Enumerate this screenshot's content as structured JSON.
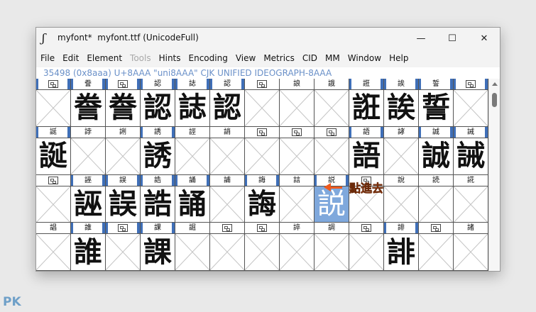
{
  "window": {
    "title": "myfont*  myfont.ttf (UnicodeFull)",
    "app_icon": "ʃ",
    "controls": {
      "minimize": "—",
      "maximize": "☐",
      "close": "✕"
    }
  },
  "menu": [
    {
      "label": "File",
      "disabled": false
    },
    {
      "label": "Edit",
      "disabled": false
    },
    {
      "label": "Element",
      "disabled": false
    },
    {
      "label": "Tools",
      "disabled": true
    },
    {
      "label": "Hints",
      "disabled": false
    },
    {
      "label": "Encoding",
      "disabled": false
    },
    {
      "label": "View",
      "disabled": false
    },
    {
      "label": "Metrics",
      "disabled": false
    },
    {
      "label": "CID",
      "disabled": false
    },
    {
      "label": "MM",
      "disabled": false
    },
    {
      "label": "Window",
      "disabled": false
    },
    {
      "label": "Help",
      "disabled": false
    }
  ],
  "info_line": "35498 (0x8aaa) U+8AAA \"uni8AAA\" CJK UNIFIED IDEOGRAPH-8AAA",
  "grid": {
    "rows": [
      [
        {
          "label": "",
          "glyph": "",
          "marked": true
        },
        {
          "label": "誊",
          "glyph": "誊",
          "marked": true
        },
        {
          "label": "",
          "glyph": "誊",
          "marked": true
        },
        {
          "label": "認",
          "glyph": "認",
          "marked": true
        },
        {
          "label": "誌",
          "glyph": "誌",
          "marked": true
        },
        {
          "label": "認",
          "glyph": "認",
          "marked": true
        },
        {
          "label": "",
          "glyph": "",
          "marked": false
        },
        {
          "label": "誏",
          "glyph": "",
          "marked": false
        },
        {
          "label": "誐",
          "glyph": "",
          "marked": false
        },
        {
          "label": "誑",
          "glyph": "誑",
          "marked": true
        },
        {
          "label": "誒",
          "glyph": "誒",
          "marked": true
        },
        {
          "label": "誓",
          "glyph": "誓",
          "marked": true
        },
        {
          "label": "",
          "glyph": "",
          "marked": true
        }
      ],
      [
        {
          "label": "誕",
          "glyph": "誕",
          "marked": true
        },
        {
          "label": "誖",
          "glyph": "",
          "marked": false
        },
        {
          "label": "誗",
          "glyph": "",
          "marked": false
        },
        {
          "label": "誘",
          "glyph": "誘",
          "marked": true
        },
        {
          "label": "誙",
          "glyph": "",
          "marked": false
        },
        {
          "label": "誚",
          "glyph": "",
          "marked": false
        },
        {
          "label": "",
          "glyph": "",
          "marked": false
        },
        {
          "label": "",
          "glyph": "",
          "marked": false
        },
        {
          "label": "",
          "glyph": "",
          "marked": false
        },
        {
          "label": "語",
          "glyph": "語",
          "marked": true
        },
        {
          "label": "誟",
          "glyph": "",
          "marked": false
        },
        {
          "label": "誠",
          "glyph": "誠",
          "marked": true
        },
        {
          "label": "誡",
          "glyph": "誡",
          "marked": true
        }
      ],
      [
        {
          "label": "",
          "glyph": "",
          "marked": false
        },
        {
          "label": "誣",
          "glyph": "誣",
          "marked": true
        },
        {
          "label": "誤",
          "glyph": "誤",
          "marked": true
        },
        {
          "label": "誥",
          "glyph": "誥",
          "marked": true
        },
        {
          "label": "誦",
          "glyph": "誦",
          "marked": true
        },
        {
          "label": "誧",
          "glyph": "",
          "marked": false
        },
        {
          "label": "誨",
          "glyph": "誨",
          "marked": true
        },
        {
          "label": "誩",
          "glyph": "",
          "marked": false
        },
        {
          "label": "説",
          "glyph": "説",
          "marked": true,
          "selected": true
        },
        {
          "label": "",
          "glyph": "",
          "marked": false
        },
        {
          "label": "說",
          "glyph": "",
          "marked": false
        },
        {
          "label": "読",
          "glyph": "",
          "marked": false
        },
        {
          "label": "誮",
          "glyph": "",
          "marked": false
        }
      ],
      [
        {
          "label": "誯",
          "glyph": "",
          "marked": false
        },
        {
          "label": "誰",
          "glyph": "誰",
          "marked": true
        },
        {
          "label": "",
          "glyph": "",
          "marked": true
        },
        {
          "label": "課",
          "glyph": "課",
          "marked": true
        },
        {
          "label": "誳",
          "glyph": "",
          "marked": false
        },
        {
          "label": "",
          "glyph": "",
          "marked": false
        },
        {
          "label": "",
          "glyph": "",
          "marked": false
        },
        {
          "label": "誶",
          "glyph": "",
          "marked": false
        },
        {
          "label": "調",
          "glyph": "",
          "marked": false
        },
        {
          "label": "",
          "glyph": "",
          "marked": false
        },
        {
          "label": "誹",
          "glyph": "誹",
          "marked": true
        },
        {
          "label": "",
          "glyph": "",
          "marked": false
        },
        {
          "label": "諸",
          "glyph": "",
          "marked": false
        }
      ]
    ]
  },
  "annotation": {
    "text": "點進去",
    "color": "#ee5a1e"
  },
  "watermark": "PK",
  "colors": {
    "selection": "#7fa8dc",
    "marker": "#3f6fb8",
    "info": "#6a90c8"
  }
}
